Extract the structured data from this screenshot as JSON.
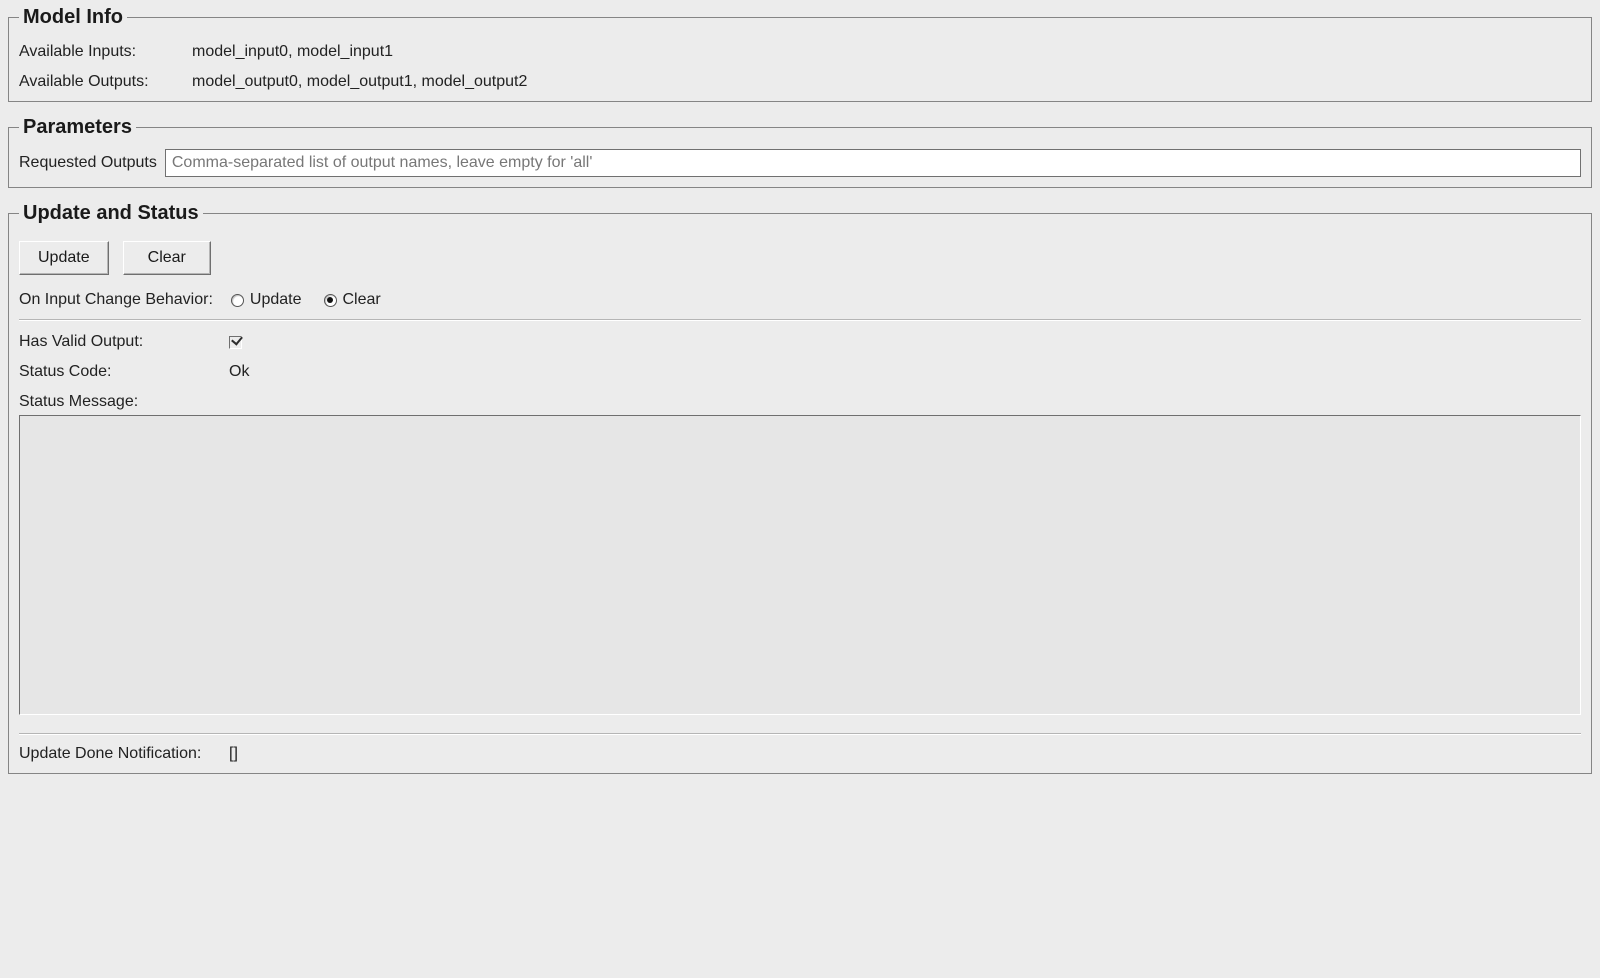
{
  "model_info": {
    "legend": "Model Info",
    "inputs_label": "Available Inputs:",
    "inputs_value": "model_input0, model_input1",
    "outputs_label": "Available Outputs:",
    "outputs_value": "model_output0, model_output1, model_output2"
  },
  "parameters": {
    "legend": "Parameters",
    "requested_outputs_label": "Requested Outputs",
    "requested_outputs_placeholder": "Comma-separated list of output names, leave empty for 'all'",
    "requested_outputs_value": ""
  },
  "update_status": {
    "legend": "Update and Status",
    "update_button": "Update",
    "clear_button": "Clear",
    "on_change_label": "On Input Change Behavior:",
    "radio_update_label": "Update",
    "radio_clear_label": "Clear",
    "on_change_selected": "Clear",
    "has_valid_output_label": "Has Valid Output:",
    "has_valid_output_checked": true,
    "status_code_label": "Status Code:",
    "status_code_value": "Ok",
    "status_message_label": "Status Message:",
    "status_message_value": "",
    "update_done_label": "Update Done Notification:",
    "update_done_value": "[]"
  }
}
